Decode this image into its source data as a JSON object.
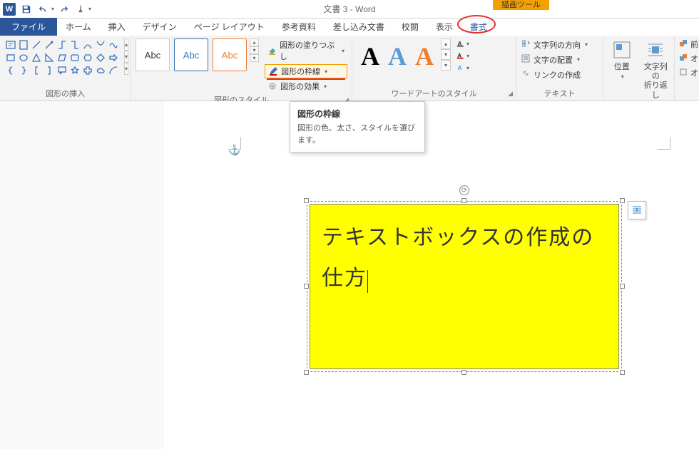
{
  "title": "文書 3 - Word",
  "context_tab": "描画ツール",
  "tabs": {
    "file": "ファイル",
    "home": "ホーム",
    "insert": "挿入",
    "design": "デザイン",
    "layout": "ページ レイアウト",
    "references": "参考資料",
    "mailings": "差し込み文書",
    "review": "校閲",
    "view": "表示",
    "format": "書式"
  },
  "groups": {
    "insert_shapes": "図形の挿入",
    "shape_styles": "図形のスタイル",
    "wordart_styles": "ワードアートのスタイル",
    "text": "テキスト"
  },
  "shape_style_menu": {
    "fill": "図形の塗りつぶし",
    "outline": "図形の枠線",
    "effects": "図形の効果"
  },
  "style_sample": "Abc",
  "wordart_sample": "A",
  "text_menu": {
    "direction": "文字列の方向",
    "align": "文字の配置",
    "link": "リンクの作成"
  },
  "big_buttons": {
    "position": "位置",
    "wrap": "文字列の\n折り返し"
  },
  "partial": {
    "front": "前",
    "back": "オ",
    "pane": "オ"
  },
  "tooltip": {
    "title": "図形の枠線",
    "body": "図形の色、太さ、スタイルを選びます。"
  },
  "textbox_content": "テキストボックスの作成の仕方"
}
